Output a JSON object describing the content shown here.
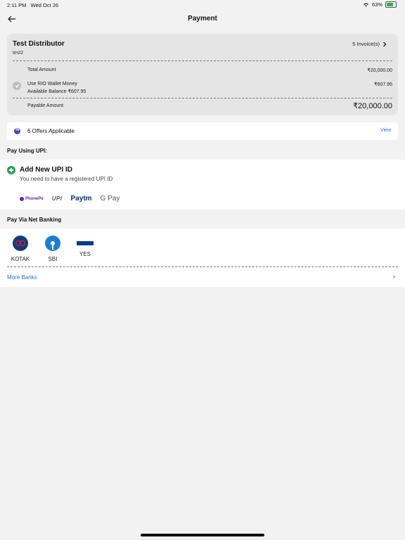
{
  "status_bar": {
    "time": "2:11 PM",
    "date": "Wed Oct 26",
    "battery": "63%",
    "battery_level": 0.63
  },
  "header": {
    "title": "Payment",
    "back_icon": "arrow-left-icon"
  },
  "distributor": {
    "name": "Test Distributor",
    "code": "test2",
    "invoices_label": "5 Invoice(s)",
    "total_amount_label": "Total Amount",
    "total_amount": "₹20,000.00",
    "wallet_label": "Use RIO Wallet Money",
    "wallet_balance": "Available Balance ₹607.95",
    "wallet_amount": "₹607.95",
    "payable_label": "Payable Amount",
    "payable_amount": "₹20,000.00"
  },
  "offers": {
    "text": "6 Offers Applicable",
    "action": "View"
  },
  "upi": {
    "section_title": "Pay Using UPI:",
    "add_label": "Add New UPI ID",
    "add_sub": "You need to have a registered UPI ID",
    "apps": [
      "PhonePe",
      "UPI",
      "Paytm",
      "G Pay"
    ]
  },
  "net_banking": {
    "section_title": "Pay Via Net Banking",
    "banks": [
      "KOTAK",
      "SBI",
      "YES"
    ],
    "more_label": "More Banks",
    "more_chevron": "›"
  },
  "colors": {
    "accent_blue": "#1e6fd9",
    "upi_green": "#2e9e5a",
    "card_bg": "#e5e5e5"
  }
}
